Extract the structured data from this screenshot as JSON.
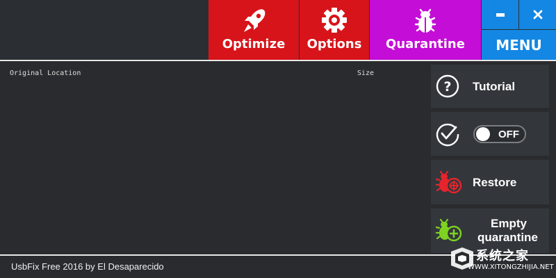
{
  "toolbar": {
    "optimize_label": "Optimize",
    "options_label": "Options",
    "quarantine_label": "Quarantine",
    "minimize_label": "–",
    "close_label": "X",
    "menu_label": "MENU"
  },
  "table": {
    "columns": [
      "Original Location",
      "Size"
    ],
    "rows": []
  },
  "side": {
    "tutorial_label": "Tutorial",
    "toggle_state": "OFF",
    "restore_label": "Restore",
    "empty_label_1": "Empty",
    "empty_label_2": "quarantine"
  },
  "footer": {
    "text": "UsbFix Free 2016 by El Desaparecido"
  },
  "watermark": {
    "main": "系统之家",
    "sub": "WWW.XITONGZHIJIA.NET"
  },
  "colors": {
    "red": "#d7141a",
    "magenta": "#c40dd7",
    "blue": "#1387e3",
    "background": "#2a2b2e",
    "panel": "#33373c"
  },
  "icons": [
    "rocket-icon",
    "gear-icon",
    "bug-icon",
    "question-icon",
    "check-icon",
    "bug-restore-icon",
    "bug-empty-icon"
  ]
}
